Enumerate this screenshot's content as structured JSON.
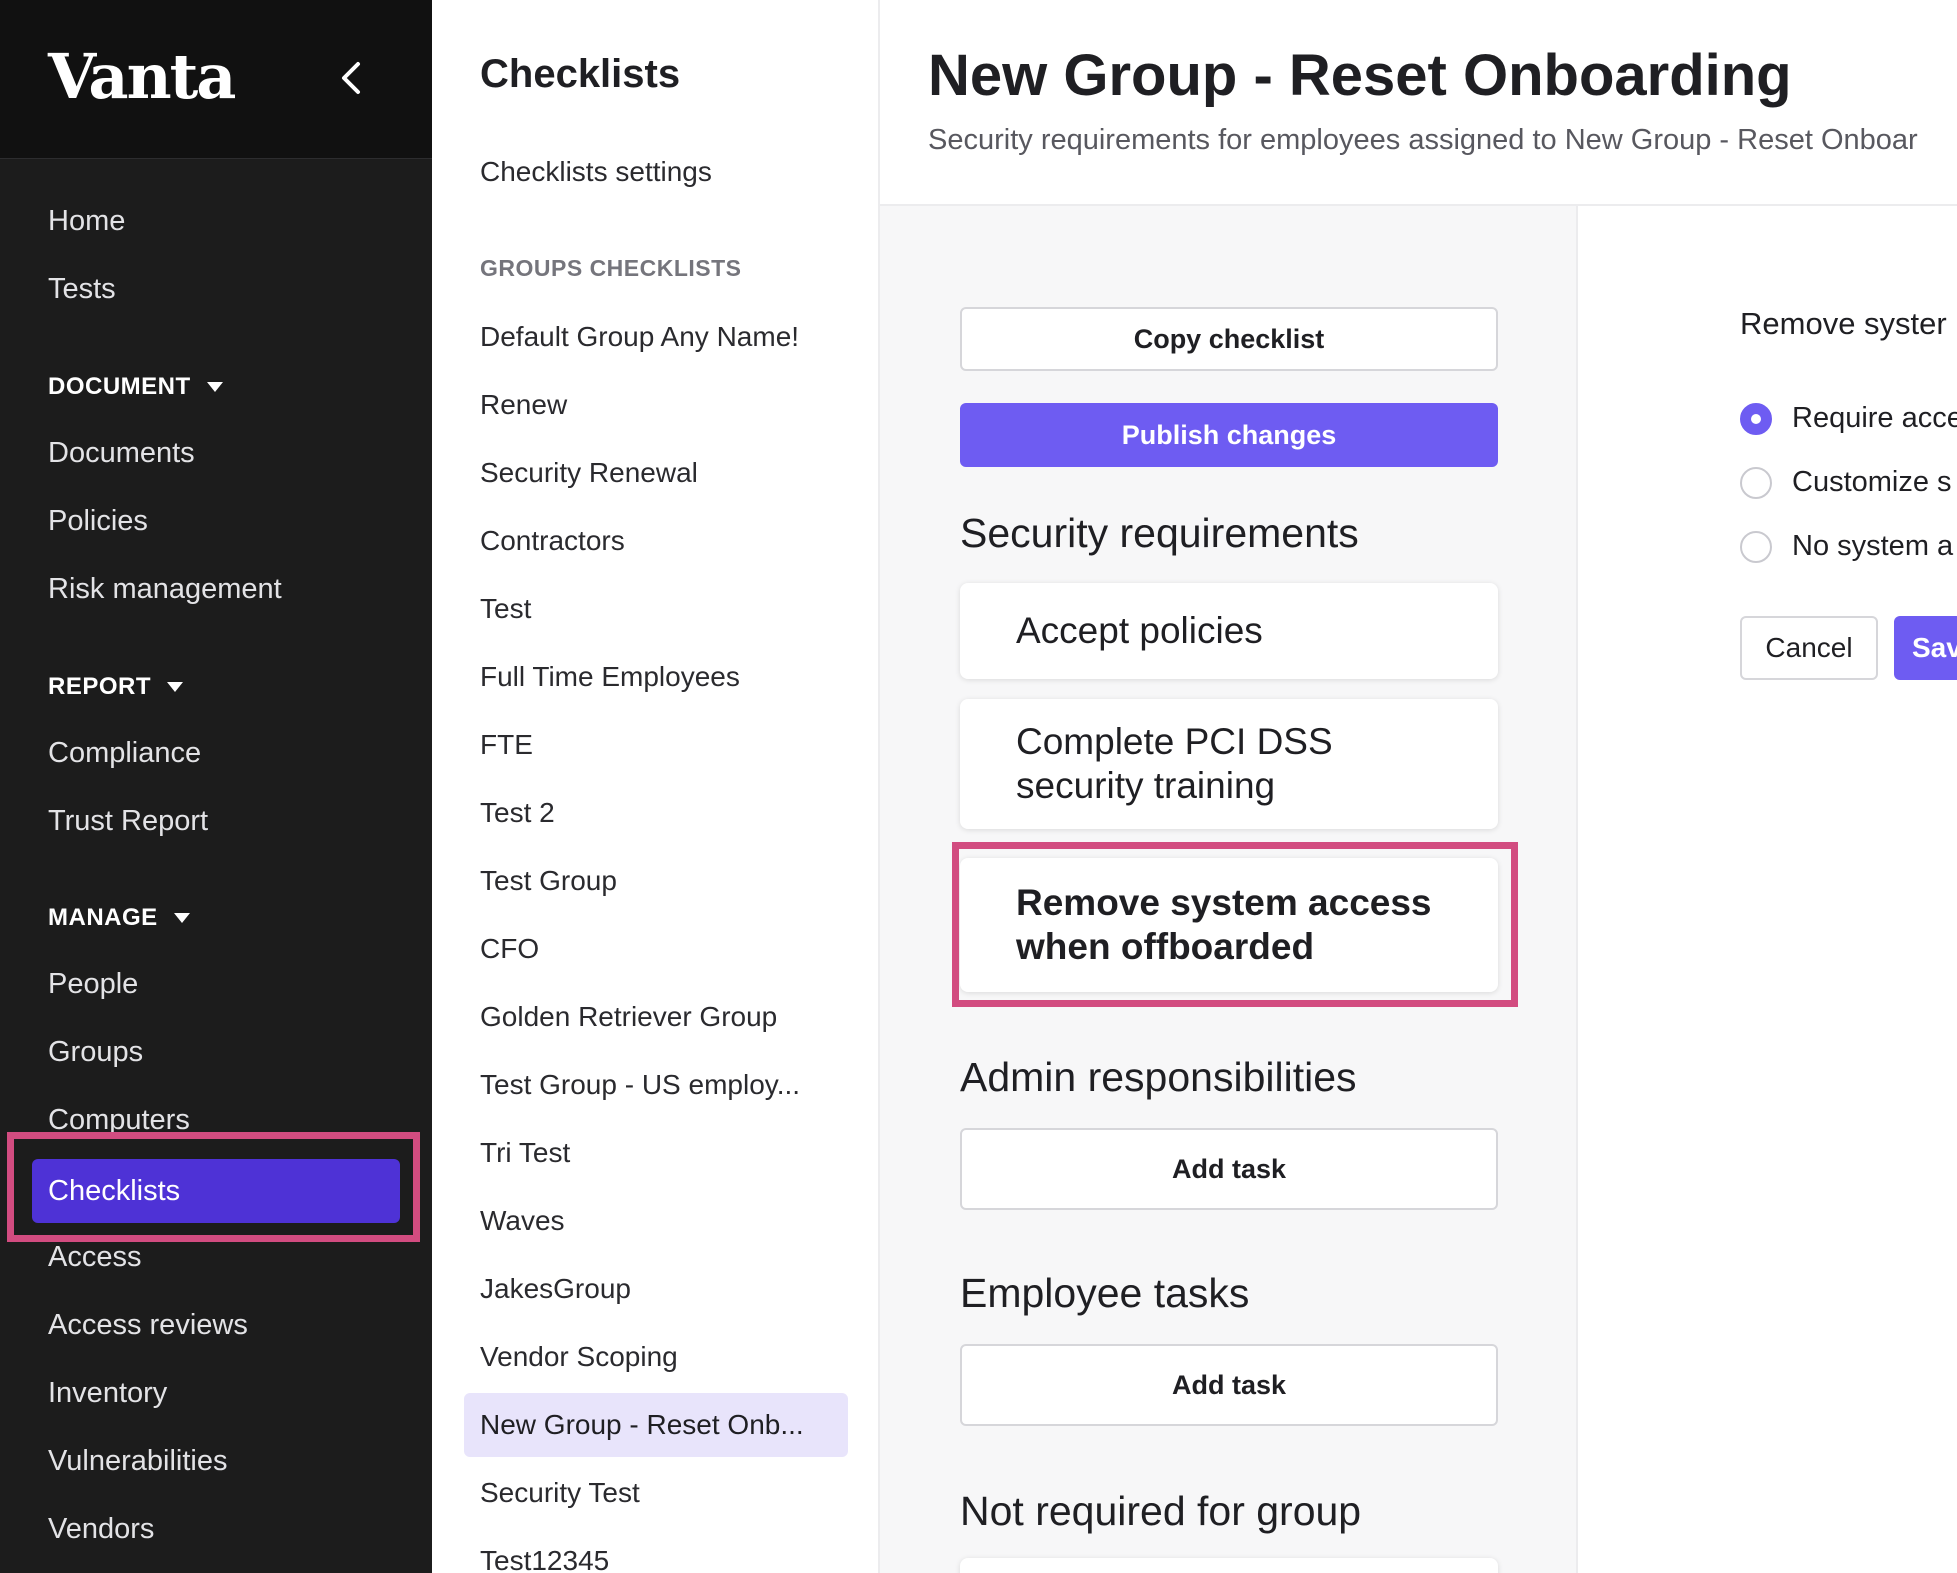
{
  "app": {
    "logo": "Vanta"
  },
  "colors": {
    "sidebar_bg": "#1c1c1c",
    "accent": "#6e5cf2",
    "sidebar_active": "#4e32d6",
    "highlight": "#d24c80",
    "selected_group_bg": "#e8e4fb"
  },
  "sidebar": {
    "top_items": [
      "Home",
      "Tests"
    ],
    "document": {
      "label": "DOCUMENT",
      "items": [
        "Documents",
        "Policies",
        "Risk management"
      ]
    },
    "report": {
      "label": "REPORT",
      "items": [
        "Compliance",
        "Trust Report"
      ]
    },
    "manage": {
      "label": "MANAGE",
      "items": [
        "People",
        "Groups",
        "Computers",
        "Checklists",
        "Access",
        "Access reviews",
        "Inventory",
        "Vulnerabilities",
        "Vendors"
      ],
      "active": "Checklists"
    }
  },
  "checklists_nav": {
    "title": "Checklists",
    "settings_link": "Checklists settings",
    "section_label": "GROUPS CHECKLISTS",
    "groups": [
      "Default Group Any Name!",
      "Renew",
      "Security Renewal",
      "Contractors",
      "Test",
      "Full Time Employees",
      "FTE",
      "Test 2",
      "Test Group",
      "CFO",
      "Golden Retriever Group",
      "Test Group - US employ...",
      "Tri Test",
      "Waves",
      "JakesGroup",
      "Vendor Scoping",
      "New Group - Reset Onb...",
      "Security Test",
      "Test12345"
    ],
    "selected": "New Group - Reset Onb..."
  },
  "main": {
    "title": "New Group - Reset Onboarding",
    "subtitle": "Security requirements for employees assigned to New Group - Reset Onboar",
    "copy_button": "Copy checklist",
    "publish_button": "Publish changes",
    "security_title": "Security requirements",
    "requirements": [
      {
        "line1": "Accept policies",
        "line2": ""
      },
      {
        "line1": "Complete PCI DSS",
        "line2": "security training"
      },
      {
        "line1": "Remove system access",
        "line2": "when offboarded"
      }
    ],
    "admin_title": "Admin responsibilities",
    "admin_add_task": "Add task",
    "employee_title": "Employee tasks",
    "employee_add_task": "Add task",
    "not_required_title": "Not required for group"
  },
  "side_panel": {
    "title": "Remove syster",
    "options": [
      {
        "label": "Require acce",
        "selected": true
      },
      {
        "label": "Customize s",
        "selected": false
      },
      {
        "label": "No system a",
        "selected": false
      }
    ],
    "cancel": "Cancel",
    "save": "Sav"
  }
}
